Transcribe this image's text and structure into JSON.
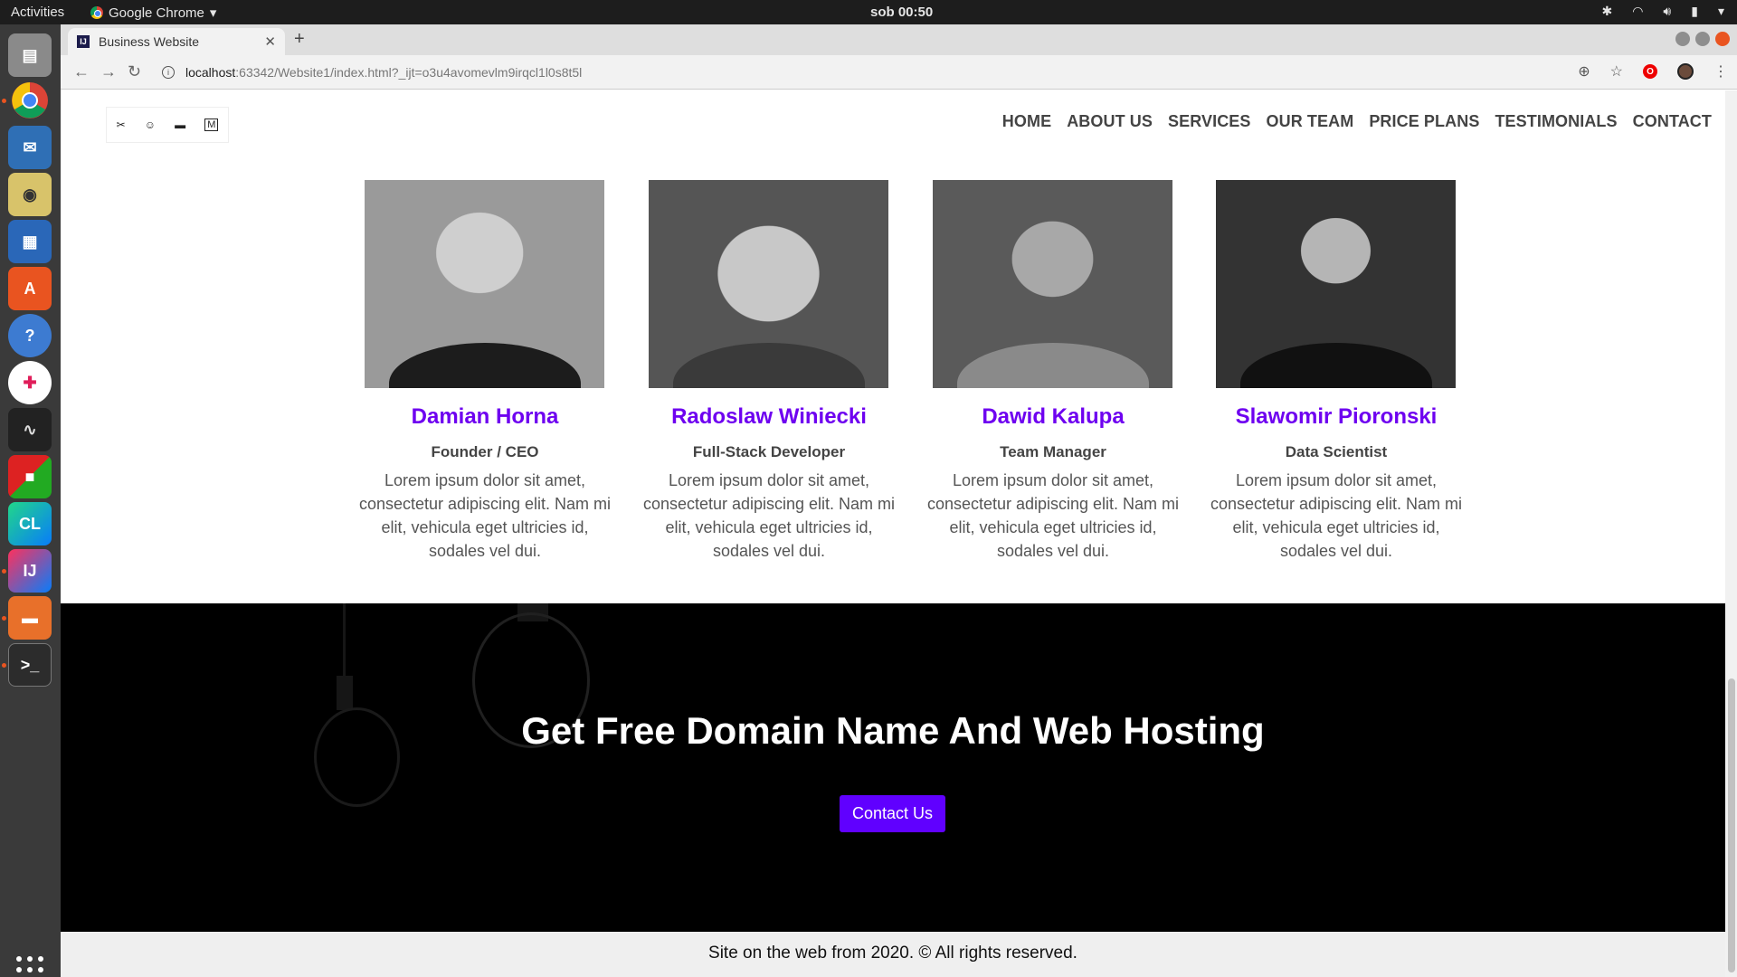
{
  "os": {
    "activities": "Activities",
    "app_name": "Google Chrome",
    "clock": "sob 00:50"
  },
  "browser": {
    "tab_title": "Business Website",
    "url_host": "localhost",
    "url_path": ":63342/Website1/index.html?_ijt=o3u4avomevlm9irqcl1l0s8t5l"
  },
  "site": {
    "nav": [
      "HOME",
      "ABOUT US",
      "SERVICES",
      "OUR TEAM",
      "PRICE PLANS",
      "TESTIMONIALS",
      "CONTACT"
    ],
    "team": [
      {
        "name": "Damian Horna",
        "role": "Founder / CEO",
        "bio": "Lorem ipsum dolor sit amet, consectetur adipiscing elit. Nam mi elit, vehicula eget ultricies id, sodales vel dui."
      },
      {
        "name": "Radoslaw Winiecki",
        "role": "Full-Stack Developer",
        "bio": "Lorem ipsum dolor sit amet, consectetur adipiscing elit. Nam mi elit, vehicula eget ultricies id, sodales vel dui."
      },
      {
        "name": "Dawid Kalupa",
        "role": "Team Manager",
        "bio": "Lorem ipsum dolor sit amet, consectetur adipiscing elit. Nam mi elit, vehicula eget ultricies id, sodales vel dui."
      },
      {
        "name": "Slawomir Pioronski",
        "role": "Data Scientist",
        "bio": "Lorem ipsum dolor sit amet, consectetur adipiscing elit. Nam mi elit, vehicula eget ultricies id, sodales vel dui."
      }
    ],
    "cta": {
      "title": "Get Free Domain Name And Web Hosting",
      "button": "Contact Us"
    },
    "footer": "Site on the web from 2020. © All rights reserved.",
    "accent_color": "#6e00f0",
    "button_color": "#6000ff"
  }
}
